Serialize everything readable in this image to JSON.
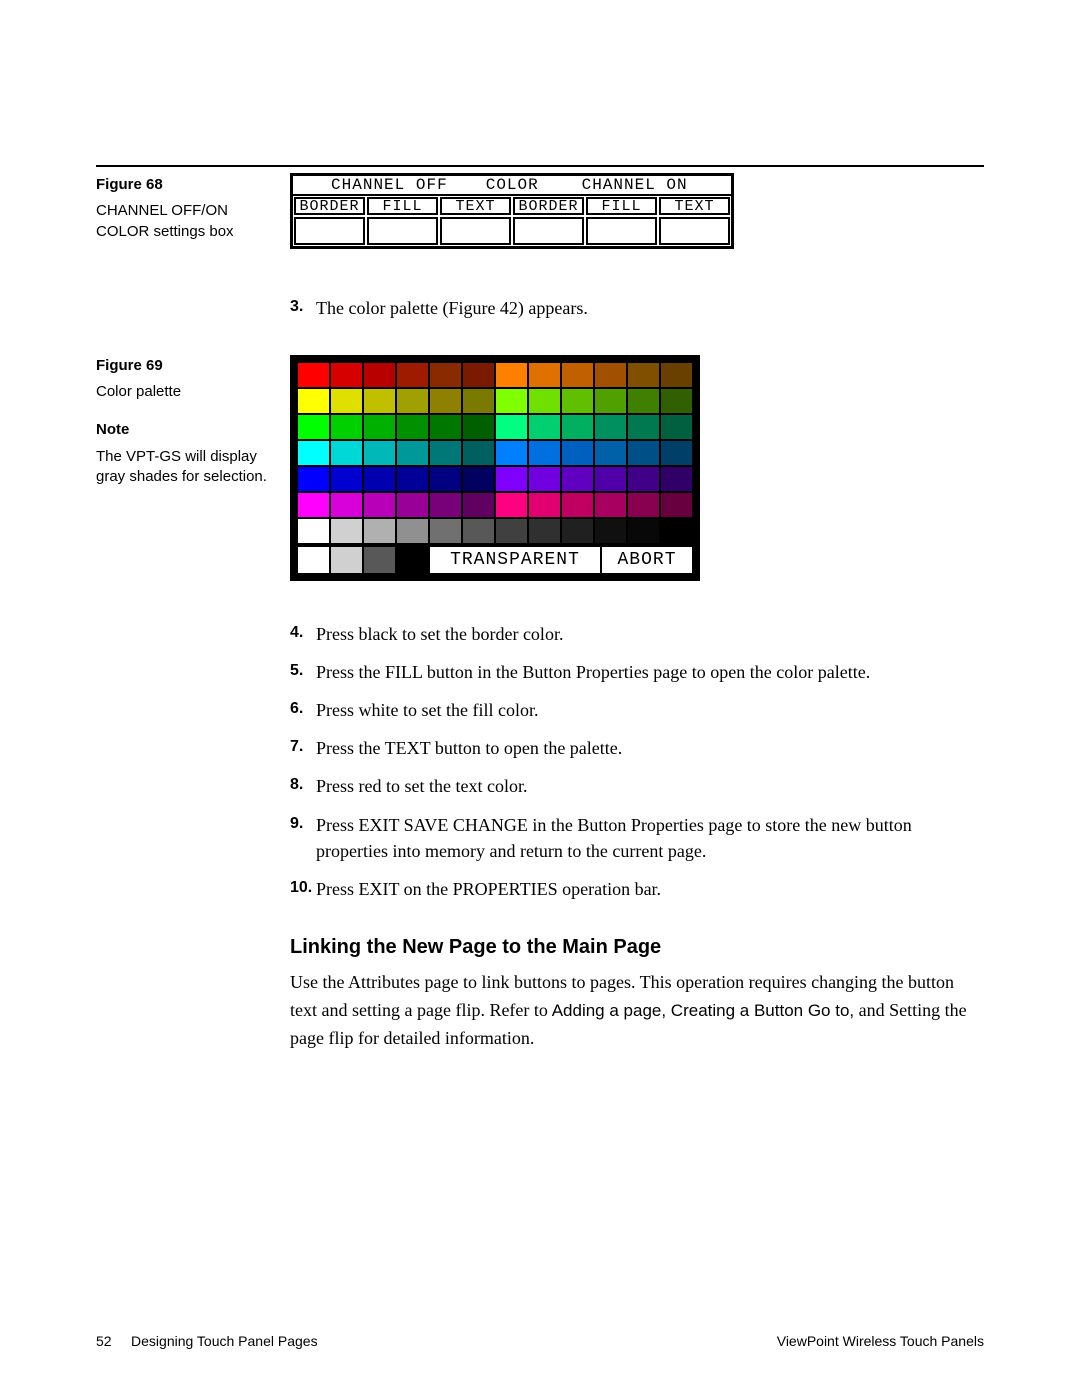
{
  "sidebar": {
    "fig68_label": "Figure 68",
    "fig68_caption": "CHANNEL OFF/ON COLOR settings box",
    "fig69_label": "Figure 69",
    "fig69_caption": "Color palette",
    "note_label": "Note",
    "note_text": "The VPT-GS will display gray shades for selection."
  },
  "settings_box": {
    "head_off": "CHANNEL OFF",
    "head_color": "COLOR",
    "head_on": "CHANNEL ON",
    "sub": [
      "BORDER",
      "FILL",
      "TEXT",
      "BORDER",
      "FILL",
      "TEXT"
    ]
  },
  "steps": {
    "s3": "The color palette (Figure 42) appears.",
    "s4": "Press black to set the border color.",
    "s5": "Press the FILL button in the Button Properties page to open the color palette.",
    "s6": "Press white to set the fill color.",
    "s7": "Press the TEXT button to open the palette.",
    "s8": "Press red to set the text color.",
    "s9": "Press EXIT SAVE CHANGE in the Button Properties page to store the new button properties into memory and return to the current page.",
    "s10": "Press EXIT on the PROPERTIES operation bar."
  },
  "palette": {
    "transparent_label": "TRANSPARENT",
    "abort_label": "ABORT",
    "rows": [
      [
        "#ff0000",
        "#d60000",
        "#b80000",
        "#9e1b00",
        "#8a2a00",
        "#7a1a00",
        "#ff8000",
        "#e07000",
        "#c06000",
        "#a05000",
        "#805000",
        "#6a4000"
      ],
      [
        "#ffff00",
        "#e0e000",
        "#c0c000",
        "#a0a000",
        "#908000",
        "#7a7a00",
        "#80ff00",
        "#70e000",
        "#60c000",
        "#50a000",
        "#408000",
        "#306000"
      ],
      [
        "#00ff00",
        "#00d000",
        "#00b000",
        "#009000",
        "#007800",
        "#006000",
        "#00ff80",
        "#00d070",
        "#00b060",
        "#009060",
        "#007850",
        "#006040"
      ],
      [
        "#00ffff",
        "#00d8d8",
        "#00b8b8",
        "#009898",
        "#007878",
        "#006060",
        "#0080ff",
        "#0070e0",
        "#0060c0",
        "#0060a8",
        "#005088",
        "#004068"
      ],
      [
        "#0000ff",
        "#0000d0",
        "#0000b0",
        "#000098",
        "#000080",
        "#000060",
        "#8000ff",
        "#7000e0",
        "#6000c0",
        "#5000a8",
        "#400088",
        "#300068"
      ],
      [
        "#ff00ff",
        "#d800d8",
        "#b800b8",
        "#980098",
        "#780078",
        "#600060",
        "#ff0080",
        "#e00070",
        "#c00060",
        "#a80060",
        "#880050",
        "#680040"
      ],
      [
        "#ffffff",
        "#d0d0d0",
        "#b0b0b0",
        "#909090",
        "#707070",
        "#585858",
        "#404040",
        "#303030",
        "#202020",
        "#101010",
        "#080808",
        "#000000"
      ]
    ],
    "footer_cells": [
      "#ffffff",
      "#d0d0d0",
      "#585858",
      "#000000"
    ]
  },
  "heading": "Linking the New Page to the Main Page",
  "para_a": "Use the Attributes page to link buttons to pages. This operation requires changing the button text and setting a page flip. Refer to",
  "para_links": " Adding a page, Creating a Button Go to,",
  "para_b": " and Setting the page flip for detailed information.",
  "footer": {
    "page_no": "52",
    "section": "Designing Touch Panel Pages",
    "doc": "ViewPoint Wireless Touch Panels"
  }
}
